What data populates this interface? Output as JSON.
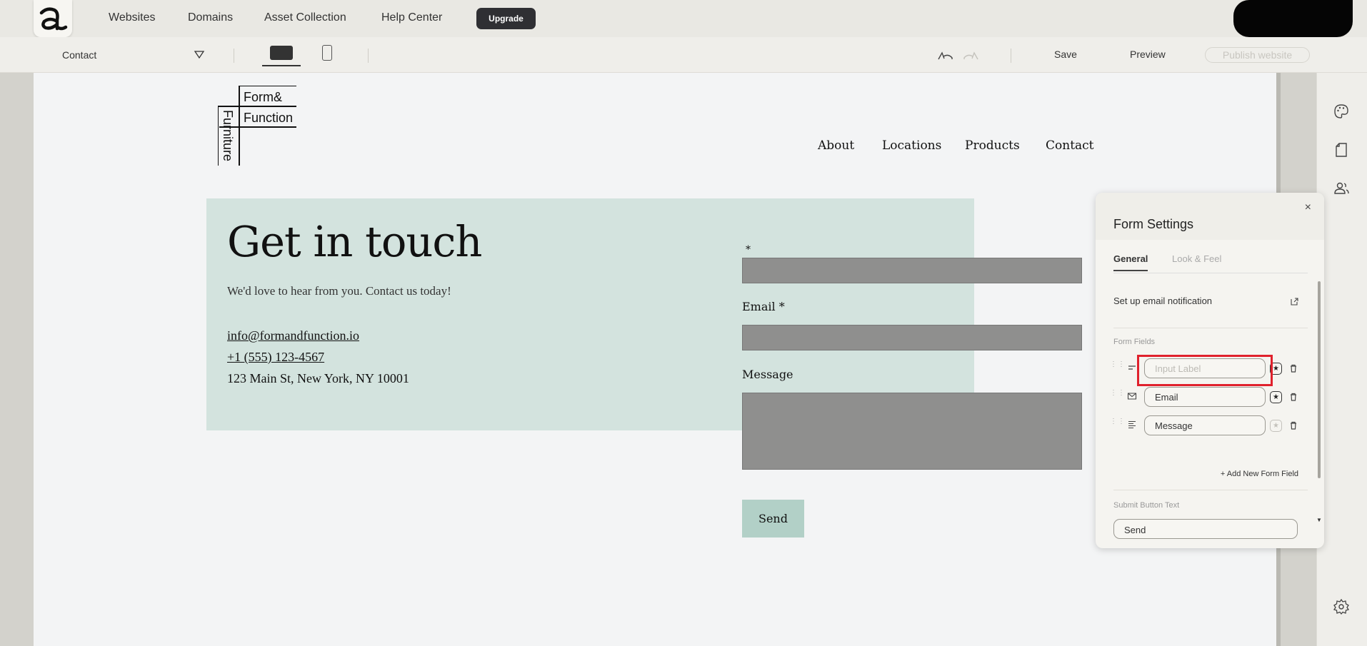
{
  "topnav": {
    "links": [
      "Websites",
      "Domains",
      "Asset Collection",
      "Help Center"
    ],
    "upgrade": "Upgrade"
  },
  "toolbar": {
    "page": "Contact",
    "save": "Save",
    "preview": "Preview",
    "publish": "Publish website"
  },
  "site": {
    "logo": {
      "line1": "Form&",
      "line2": "Function",
      "vertical": "Furniture"
    },
    "nav": [
      "About",
      "Locations",
      "Products",
      "Contact"
    ],
    "hero_title": "Get in touch",
    "hero_sub": "We'd love to hear from you. Contact us today!",
    "email": "info@formandfunction.io",
    "phone": "+1 (555) 123-4567",
    "address": "123 Main St, New York, NY 10001",
    "form": {
      "field1_label": "*",
      "email_label": "Email",
      "message_label": "Message",
      "required_mark": "*",
      "send": "Send"
    }
  },
  "panel": {
    "close": "×",
    "title": "Form Settings",
    "tabs": [
      "General",
      "Look & Feel"
    ],
    "email_notification": "Set up email notification",
    "fields_label": "Form Fields",
    "fields": [
      {
        "value": "",
        "placeholder": "Input Label",
        "type_icon": "short-text-icon",
        "required": true
      },
      {
        "value": "Email",
        "placeholder": "",
        "type_icon": "envelope-icon",
        "required": true
      },
      {
        "value": "Message",
        "placeholder": "",
        "type_icon": "paragraph-icon",
        "required": false
      }
    ],
    "add_field": "+ Add New Form Field",
    "submit_label": "Submit Button Text",
    "submit_value": "Send"
  },
  "colors": {
    "hero_bg": "#d3e3de",
    "send_bg": "#b2d0c7",
    "input_bg": "#8f8f8e",
    "highlight": "#e0212c",
    "upgrade_bg": "#2f2f33"
  }
}
